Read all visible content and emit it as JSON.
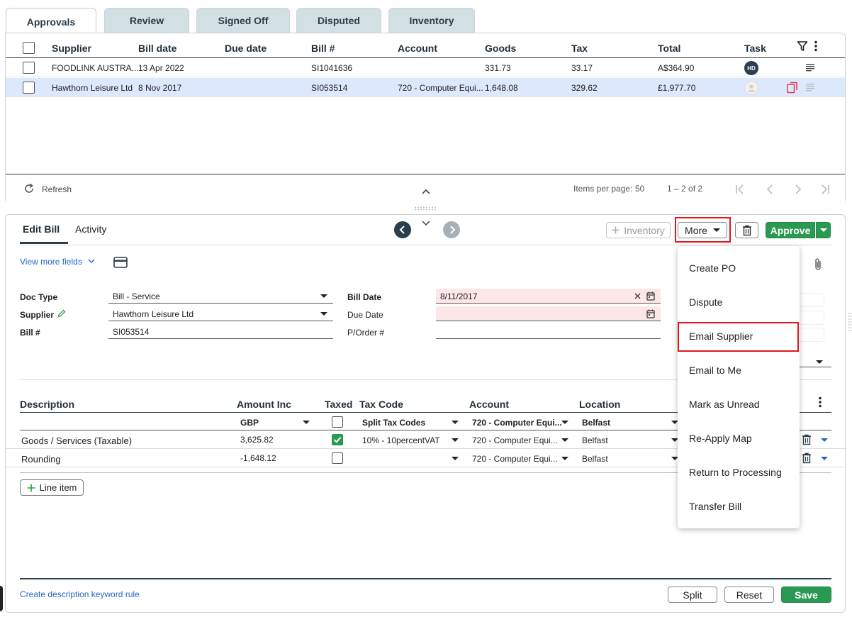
{
  "tabs": [
    "Approvals",
    "Review",
    "Signed Off",
    "Disputed",
    "Inventory"
  ],
  "grid": {
    "columns": [
      "Supplier",
      "Bill date",
      "Due date",
      "Bill #",
      "Account",
      "Goods",
      "Tax",
      "Total",
      "Task"
    ],
    "rows": [
      {
        "supplier": "FOODLINK AUSTRA...",
        "bill_date": "13 Apr 2022",
        "due_date": "",
        "bill_no": "SI1041636",
        "account": "",
        "goods": "331.73",
        "tax": "33.17",
        "total": "A$364.90",
        "task_initials": "HD"
      },
      {
        "supplier": "Hawthorn Leisure Ltd",
        "bill_date": "8 Nov 2017",
        "due_date": "",
        "bill_no": "SI053514",
        "account": "720 - Computer Equi...",
        "goods": "1,648.08",
        "tax": "329.62",
        "total": "£1,977.70",
        "task_initials": ""
      }
    ],
    "footer": {
      "refresh": "Refresh",
      "items_per_page_label": "Items per page:",
      "items_per_page": "50",
      "range": "1 – 2 of 2"
    }
  },
  "edit": {
    "tabs": [
      "Edit Bill",
      "Activity"
    ],
    "toolbar": {
      "inventory": "Inventory",
      "more": "More",
      "approve": "Approve"
    },
    "view_more": "View more fields",
    "fields": {
      "doc_type_label": "Doc Type",
      "doc_type": "Bill - Service",
      "supplier_label": "Supplier",
      "supplier": "Hawthorn Leisure Ltd",
      "bill_no_label": "Bill #",
      "bill_no": "SI053514",
      "bill_date_label": "Bill Date",
      "bill_date": "8/11/2017",
      "due_date_label": "Due Date",
      "due_date": "",
      "po_label": "P/Order #",
      "po": ""
    },
    "lines": {
      "columns": [
        "Description",
        "Amount Inc",
        "Taxed",
        "Tax Code",
        "Account",
        "Location"
      ],
      "sub": {
        "currency": "GBP",
        "tax_code": "Split Tax Codes",
        "account": "720 - Computer Equi...",
        "location": "Belfast"
      },
      "rows": [
        {
          "description": "Goods / Services (Taxable)",
          "amount": "3,625.82",
          "taxed": true,
          "tax_code": "10% - 10percentVAT",
          "account": "720 - Computer Equi...",
          "location": "Belfast"
        },
        {
          "description": "Rounding",
          "amount": "-1,648.12",
          "taxed": false,
          "tax_code": "",
          "account": "720 - Computer Equi...",
          "location": "Belfast"
        }
      ],
      "add_line": "Line item"
    },
    "footer": {
      "keyword_rule": "Create description keyword rule",
      "split": "Split",
      "reset": "Reset",
      "save": "Save"
    }
  },
  "more_menu": [
    "Create PO",
    "Dispute",
    "Email Supplier",
    "Email to Me",
    "Mark as Unread",
    "Re-Apply Map",
    "Return to Processing",
    "Transfer Bill"
  ],
  "colors": {
    "accent_green": "#2a9a52",
    "highlight_red": "#e3161e",
    "tab_inactive": "#d3e0e3",
    "selected_row": "#dce8fb",
    "pink_field": "#fde6e8"
  }
}
